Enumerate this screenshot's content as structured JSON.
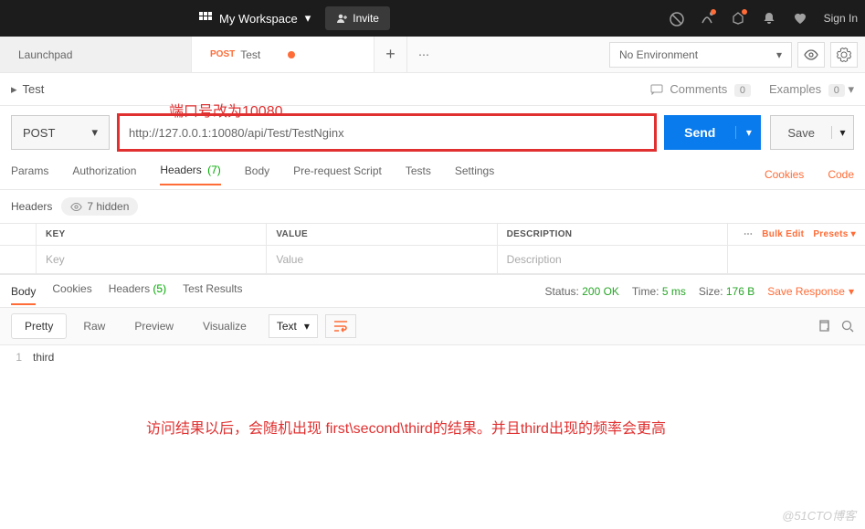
{
  "topbar": {
    "workspace_label": "My Workspace",
    "invite_label": "Invite",
    "signin_label": "Sign In"
  },
  "tabs": {
    "launchpad": "Launchpad",
    "active_method": "POST",
    "active_name": "Test",
    "add_label": "+",
    "more_label": "⋯"
  },
  "env": {
    "selected": "No Environment"
  },
  "title": {
    "caret": "▸",
    "name": "Test",
    "comments_label": "Comments",
    "comments_count": "0",
    "examples_label": "Examples",
    "examples_count": "0"
  },
  "annotations": {
    "top": "端口号改为10080",
    "bottom": "访问结果以后，会随机出现 first\\second\\third的结果。并且third出现的频率会更高"
  },
  "request": {
    "method": "POST",
    "url": "http://127.0.0.1:10080/api/Test/TestNginx",
    "send_label": "Send",
    "save_label": "Save"
  },
  "req_tabs": {
    "params": "Params",
    "authorization": "Authorization",
    "headers": "Headers",
    "headers_count": "(7)",
    "body": "Body",
    "prerequest": "Pre-request Script",
    "tests": "Tests",
    "settings": "Settings",
    "cookies": "Cookies",
    "code": "Code"
  },
  "headers_section": {
    "label": "Headers",
    "hidden_label": "7 hidden"
  },
  "kv": {
    "key_header": "KEY",
    "value_header": "VALUE",
    "desc_header": "DESCRIPTION",
    "bulk_edit": "Bulk Edit",
    "presets": "Presets",
    "key_ph": "Key",
    "value_ph": "Value",
    "desc_ph": "Description"
  },
  "resp_tabs": {
    "body": "Body",
    "cookies": "Cookies",
    "headers": "Headers",
    "headers_count": "(5)",
    "test_results": "Test Results",
    "status_label": "Status:",
    "status_value": "200 OK",
    "time_label": "Time:",
    "time_value": "5 ms",
    "size_label": "Size:",
    "size_value": "176 B",
    "save_response": "Save Response"
  },
  "pretty": {
    "pretty": "Pretty",
    "raw": "Raw",
    "preview": "Preview",
    "visualize": "Visualize",
    "format": "Text"
  },
  "response_body": {
    "line_no": "1",
    "content": "third"
  },
  "watermark": "@51CTO博客",
  "colors": {
    "accent": "#ff6c37",
    "primary": "#097bed",
    "danger": "#e03030",
    "success": "#28a528"
  }
}
